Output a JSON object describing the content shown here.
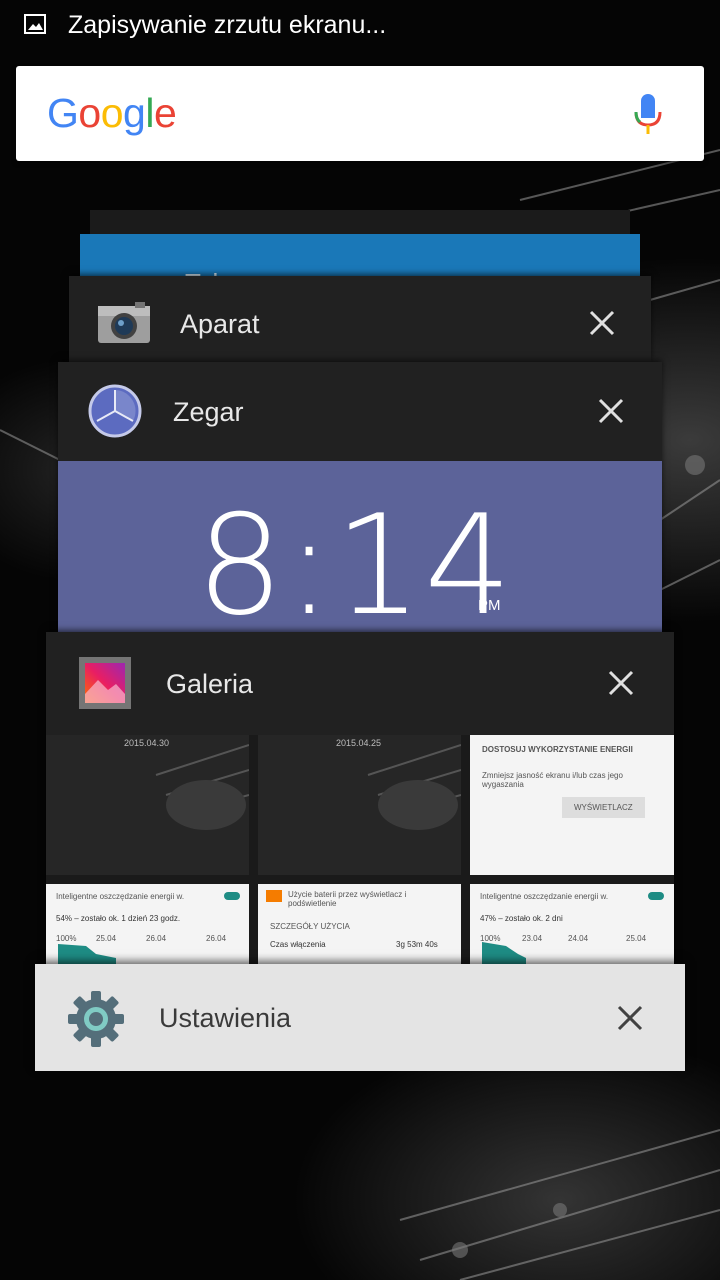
{
  "status_bar": {
    "icon": "image-icon",
    "notification_text": "Zapisywanie zrzutu ekranu..."
  },
  "search": {
    "logo_letters": [
      "G",
      "o",
      "o",
      "g",
      "l",
      "e"
    ],
    "logo_colors": [
      "#4285F4",
      "#EA4335",
      "#FBBC05",
      "#4285F4",
      "#34A853",
      "#EA4335"
    ],
    "mic_icon": "mic-icon"
  },
  "recents": {
    "peek_card_text": "Tel",
    "cards": [
      {
        "id": "aparat",
        "label": "Aparat",
        "icon": "camera-icon",
        "close_icon": "close-icon"
      },
      {
        "id": "zegar",
        "label": "Zegar",
        "icon": "clock-icon",
        "close_icon": "close-icon"
      },
      {
        "id": "galeria",
        "label": "Galeria",
        "icon": "gallery-icon",
        "close_icon": "close-icon"
      },
      {
        "id": "ustawienia",
        "label": "Ustawienia",
        "icon": "settings-gear-icon",
        "close_icon": "close-icon"
      }
    ]
  },
  "clock_preview": {
    "time": "8:14",
    "ampm": "PM"
  },
  "gallery_preview": {
    "dates": [
      "2015.04.30",
      "2015.04.25"
    ],
    "settings_thumb": {
      "heading": "DOSTOSUJ WYKORZYSTANIE ENERGII",
      "text": "Zmniejsz jasność ekranu i/lub czas jego wygaszania",
      "button": "WYŚWIETLACZ"
    },
    "battery_thumbs": [
      {
        "title": "Inteligentne oszczędzanie energii w.",
        "summary": "54% – zostało ok. 1 dzień 23 godz.",
        "axis": [
          "100%",
          "25.04",
          "26.04",
          "26.04"
        ]
      },
      {
        "title": "Użycie baterii przez wyświetlacz i podświetlenie",
        "section": "SZCZEGÓŁY UŻYCIA",
        "row": "Czas włączenia",
        "row_value": "3g 53m 40s"
      },
      {
        "title": "Inteligentne oszczędzanie energii w.",
        "summary": "47% – zostało ok. 2 dni",
        "axis": [
          "100%",
          "23.04",
          "24.04",
          "25.04"
        ]
      }
    ]
  },
  "colors": {
    "zegar_preview": "#5C6399",
    "card_dark": "#212121",
    "card_light": "#E4E4E4",
    "battery_graph": "#1E8C84"
  }
}
